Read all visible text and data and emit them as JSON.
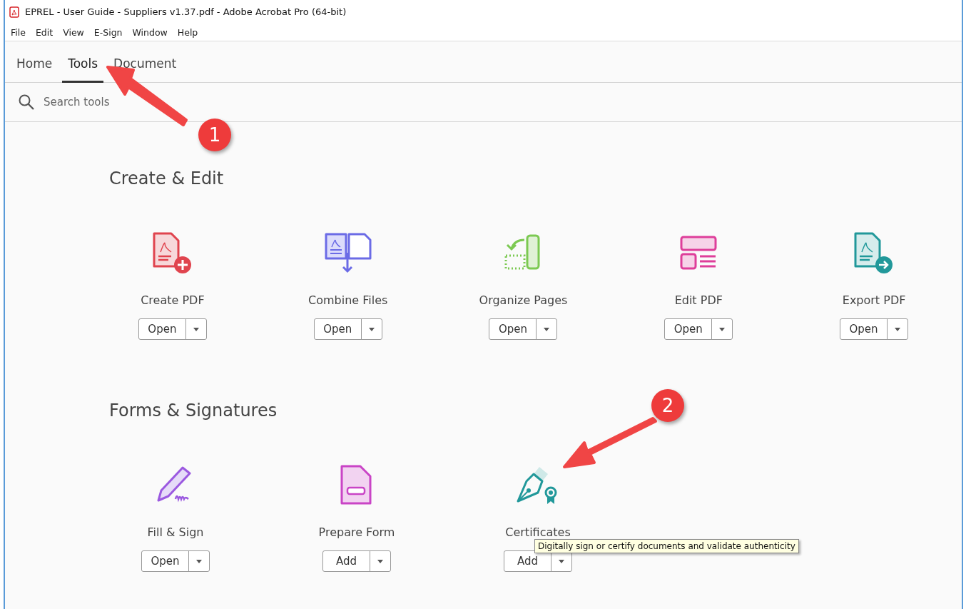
{
  "window": {
    "title": "EPREL - User Guide - Suppliers v1.37.pdf - Adobe Acrobat Pro (64-bit)"
  },
  "menu": [
    "File",
    "Edit",
    "View",
    "E-Sign",
    "Window",
    "Help"
  ],
  "tabs": [
    {
      "label": "Home",
      "selected": false
    },
    {
      "label": "Tools",
      "selected": true
    },
    {
      "label": "Document",
      "selected": false
    }
  ],
  "search": {
    "placeholder": "Search tools"
  },
  "sections": [
    {
      "title": "Create & Edit",
      "tools": [
        {
          "label": "Create PDF",
          "action": "Open"
        },
        {
          "label": "Combine Files",
          "action": "Open"
        },
        {
          "label": "Organize Pages",
          "action": "Open"
        },
        {
          "label": "Edit PDF",
          "action": "Open"
        },
        {
          "label": "Export PDF",
          "action": "Open"
        }
      ]
    },
    {
      "title": "Forms & Signatures",
      "tools": [
        {
          "label": "Fill & Sign",
          "action": "Open"
        },
        {
          "label": "Prepare Form",
          "action": "Add"
        },
        {
          "label": "Certificates",
          "action": "Add"
        }
      ]
    }
  ],
  "tooltip": "Digitally sign or certify documents and validate authenticity",
  "callouts": [
    "1",
    "2"
  ]
}
